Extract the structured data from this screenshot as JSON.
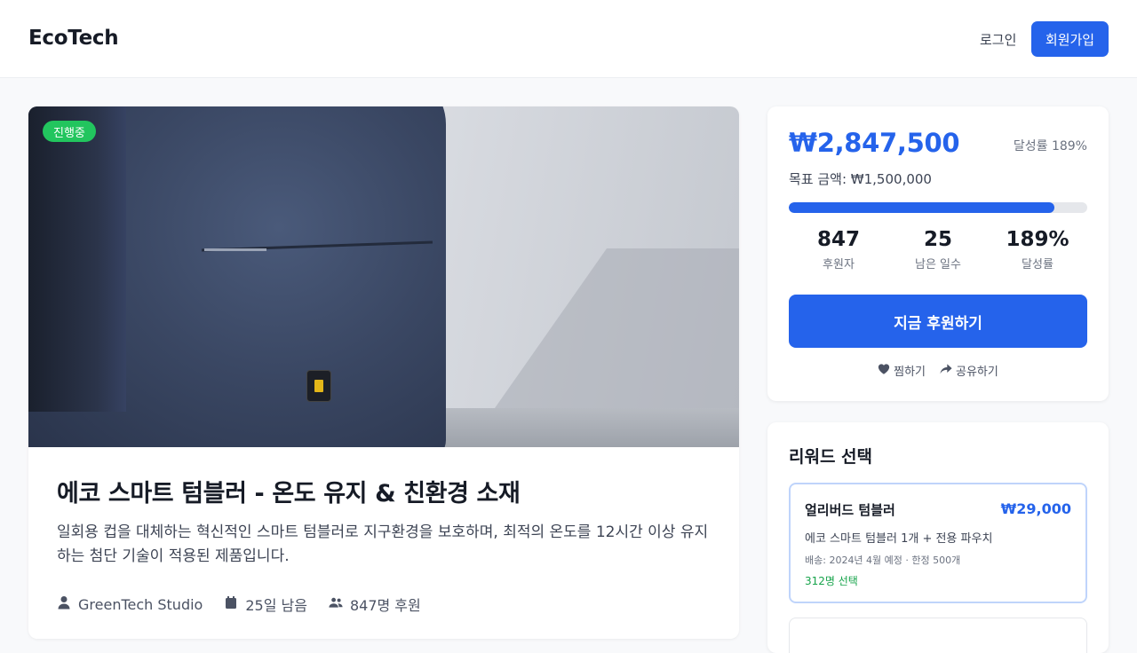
{
  "header": {
    "logo": "EcoTech",
    "login_label": "로그인",
    "signup_label": "회원가입"
  },
  "project": {
    "status_badge": "진행중",
    "title": "에코 스마트 텀블러 - 온도 유지 & 친환경 소재",
    "description": "일회용 컵을 대체하는 혁신적인 스마트 텀블러로 지구환경을 보호하며, 최적의 온도를 12시간 이상 유지하는 첨단 기술이 적용된 제품입니다.",
    "meta": {
      "creator": "GreenTech Studio",
      "days_left": "25일 남음",
      "backers": "847명 후원"
    }
  },
  "funding": {
    "amount": "₩2,847,500",
    "rate_label": "달성률 189%",
    "goal": "목표 금액: ₩1,500,000",
    "progress_fraction": 0.89,
    "stats": [
      {
        "value": "847",
        "label": "후원자"
      },
      {
        "value": "25",
        "label": "남은 일수"
      },
      {
        "value": "189%",
        "label": "달성률"
      }
    ],
    "cta_label": "지금 후원하기",
    "like_label": "찜하기",
    "share_label": "공유하기"
  },
  "rewards": {
    "title": "리워드 선택",
    "items": [
      {
        "name": "얼리버드 텀블러",
        "price": "₩29,000",
        "description": "에코 스마트 텀블러 1개 + 전용 파우치",
        "shipping": "배송: 2024년 4월 예정 · 한정 500개",
        "selected_count": "312명 선택"
      }
    ]
  },
  "colors": {
    "accent": "#2563eb",
    "badge_green": "#22c55e",
    "success_text": "#16a34a"
  }
}
